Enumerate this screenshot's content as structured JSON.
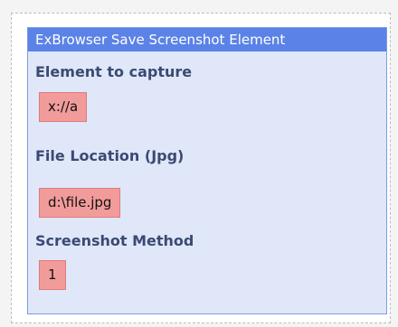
{
  "activity": {
    "title": "ExBrowser Save Screenshot Element",
    "fields": [
      {
        "label": "Element to capture",
        "value": "x://a"
      },
      {
        "label": "File Location (Jpg)",
        "value": "d:\\file.jpg"
      },
      {
        "label": "Screenshot Method",
        "value": "1"
      }
    ]
  },
  "colors": {
    "header": "#5b82e6",
    "panel": "#dfe7f9",
    "value_bg": "#f29b9b",
    "label_text": "#3b4a73"
  }
}
